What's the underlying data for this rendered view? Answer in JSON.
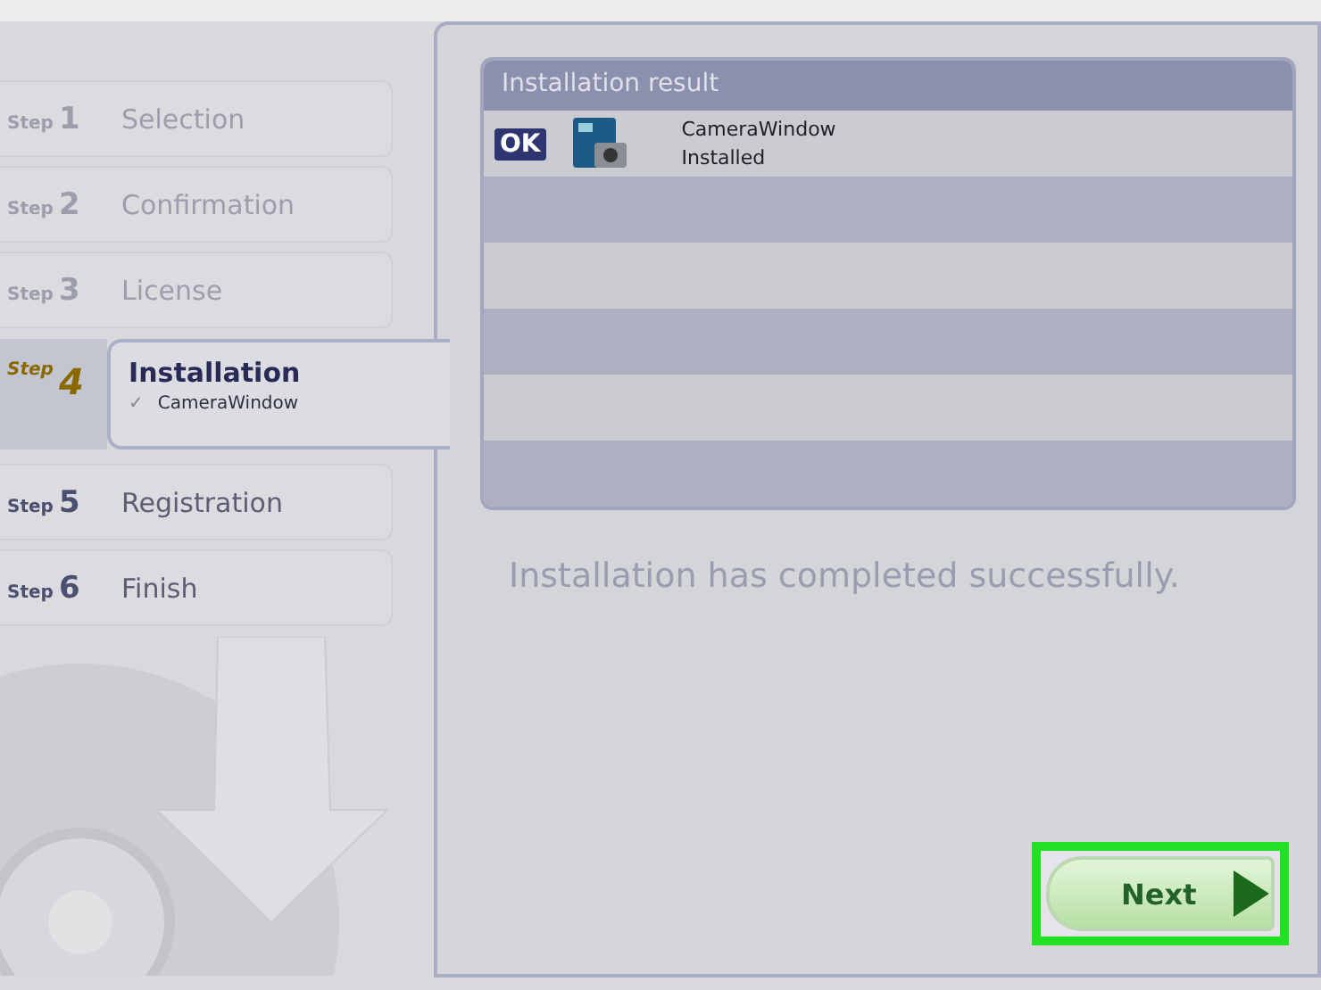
{
  "steps": [
    {
      "prefix": "Step",
      "number": "1",
      "label": "Selection",
      "disabled": true,
      "selected": false
    },
    {
      "prefix": "Step",
      "number": "2",
      "label": "Confirmation",
      "disabled": true,
      "selected": false
    },
    {
      "prefix": "Step",
      "number": "3",
      "label": "License",
      "disabled": true,
      "selected": false
    },
    {
      "prefix": "Step",
      "number": "4",
      "label": "Installation",
      "disabled": false,
      "selected": true,
      "items": [
        {
          "mark": "✓",
          "label": "CameraWindow"
        }
      ]
    },
    {
      "prefix": "Step",
      "number": "5",
      "label": "Registration",
      "disabled": false,
      "selected": false
    },
    {
      "prefix": "Step",
      "number": "6",
      "label": "Finish",
      "disabled": false,
      "selected": false
    }
  ],
  "result": {
    "title": "Installation result",
    "rows": [
      {
        "badge": "OK",
        "name": "CameraWindow",
        "status": "Installed"
      }
    ]
  },
  "message": "Installation has completed successfully.",
  "next_button": {
    "label": "Next",
    "highlighted": true
  }
}
